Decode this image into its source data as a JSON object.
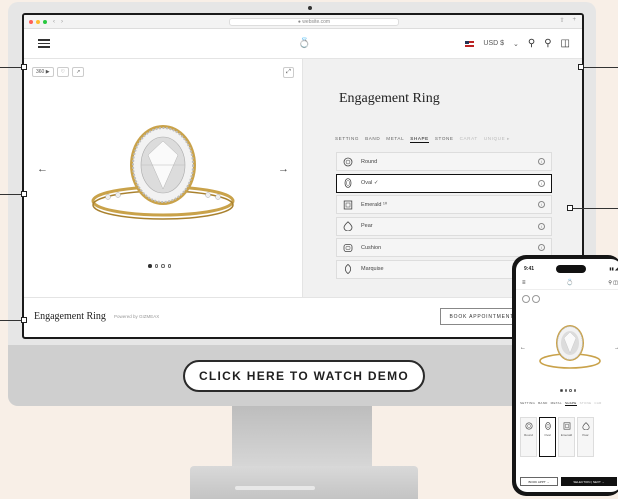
{
  "browser": {
    "url": "● website.com",
    "traffic_colors": [
      "#ff5f57",
      "#febc2e",
      "#28c840"
    ]
  },
  "site": {
    "logo": "💍",
    "currency": "USD $",
    "menu_icon": "menu-icon",
    "header_icons": [
      "user-icon",
      "search-icon",
      "bag-icon"
    ]
  },
  "viewer": {
    "tools": [
      "360 ▶",
      "♡",
      "↗"
    ],
    "expand": "⤢",
    "prev": "←",
    "next": "→",
    "pages": 4,
    "active_page": 0
  },
  "configurator": {
    "title": "Engagement Ring",
    "steps": [
      {
        "label": "SETTING",
        "state": "done"
      },
      {
        "label": "BAND",
        "state": "done"
      },
      {
        "label": "METAL",
        "state": "done"
      },
      {
        "label": "SHAPE",
        "state": "active"
      },
      {
        "label": "STONE",
        "state": "done"
      },
      {
        "label": "CARAT",
        "state": "dim"
      },
      {
        "label": "UNIQUE ▸",
        "state": "dim"
      }
    ],
    "shapes": [
      {
        "label": "Round",
        "icon": "round-icon",
        "selected": false
      },
      {
        "label": "Oval ✓",
        "icon": "oval-icon",
        "selected": true
      },
      {
        "label": "Emerald ¹⁰",
        "icon": "emerald-icon",
        "selected": false
      },
      {
        "label": "Pear",
        "icon": "pear-icon",
        "selected": false
      },
      {
        "label": "Cushion",
        "icon": "cushion-icon",
        "selected": false
      },
      {
        "label": "Marquise",
        "icon": "marquise-icon",
        "selected": false
      }
    ],
    "info_icon": "i"
  },
  "footer": {
    "title": "Engagement Ring",
    "subtitle": "Powered by GIZMEAX",
    "book_label": "BOOK APPOINTMENT"
  },
  "cta": {
    "label": "CLICK HERE TO WATCH DEMO"
  },
  "phone": {
    "time": "9:41",
    "status": "▮▮ ◢",
    "steps": [
      {
        "label": "SETTING",
        "state": "done"
      },
      {
        "label": "BAND",
        "state": "done"
      },
      {
        "label": "METAL",
        "state": "done"
      },
      {
        "label": "SHAPE",
        "state": "active"
      },
      {
        "label": "STONE",
        "state": "dim"
      },
      {
        "label": "CAR",
        "state": "dim"
      }
    ],
    "shapes": [
      {
        "label": "Round",
        "selected": false
      },
      {
        "label": "Oval",
        "selected": true
      },
      {
        "label": "Emerald",
        "selected": false
      },
      {
        "label": "Pear",
        "selected": false
      }
    ],
    "book_label": "BOOK APPT →",
    "next_label": "SELECTION  |  NEXT →"
  },
  "colors": {
    "background": "#f8efe7",
    "gold": "#c9a24a",
    "accent_dark": "#111111"
  }
}
